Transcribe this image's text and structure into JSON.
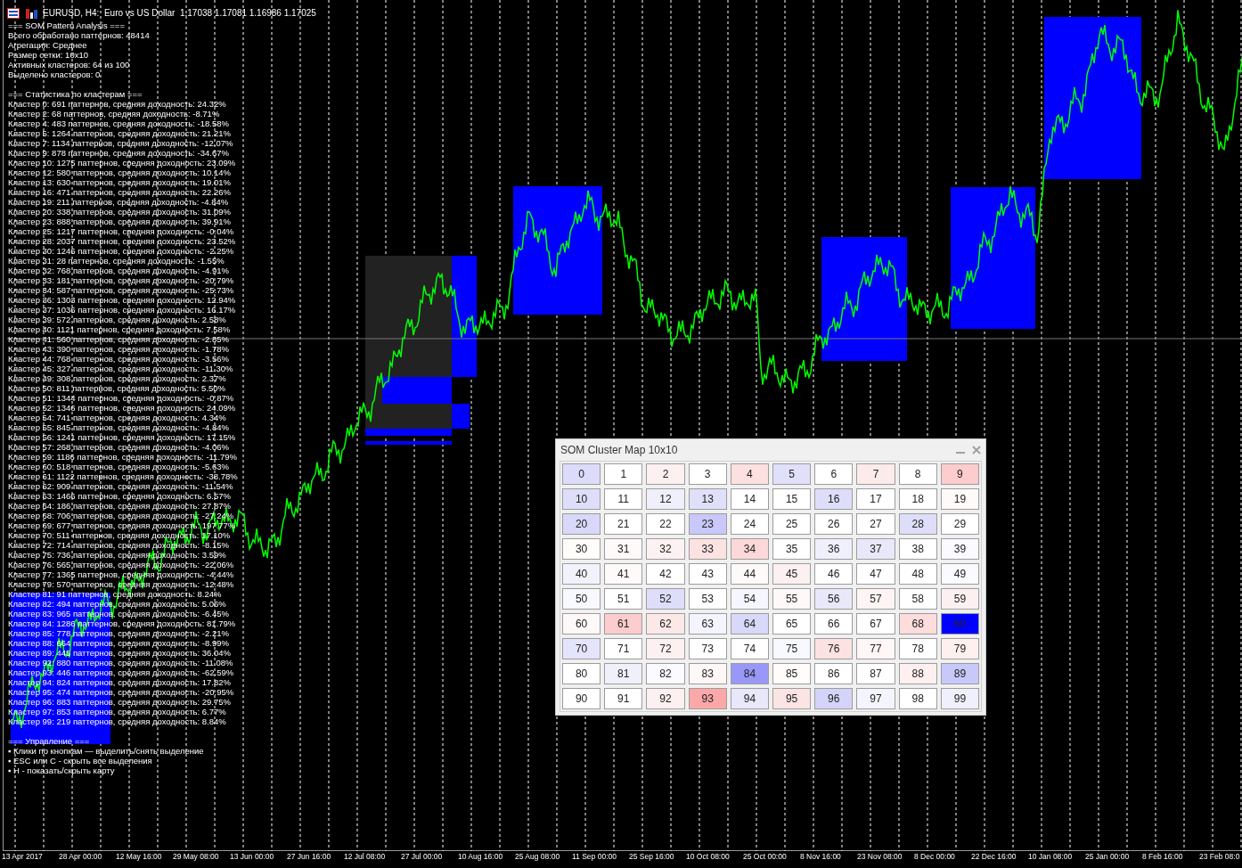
{
  "title_bar": {
    "text": "EURUSD, H4:  Euro vs US Dollar  1.17038 1.17081 1.16986 1.17025"
  },
  "analysis": {
    "header": [
      "=== SOM Pattern Analysis ===",
      "Всего обработано паттернов: 48414",
      "Агрегация: Среднее",
      "Размер сетки: 10x10",
      "Активных кластеров: 64 из 100",
      "Выделено кластеров: 0"
    ],
    "stats_title": "=== Статистика по кластерам ===",
    "clusters": [
      "Кластер 0: 691 паттернов, средняя доходность: 24.32%",
      "Кластер 2: 68 паттернов, средняя доходность: -8.71%",
      "Кластер 4: 483 паттернов, средняя доходность: -18.58%",
      "Кластер 5: 1264 паттернов, средняя доходность: 21.21%",
      "Кластер 7: 1134 паттернов, средняя доходность: -12.07%",
      "Кластер 9: 878 паттернов, средняя доходность: -34.67%",
      "Кластер 10: 1275 паттернов, средняя доходность: 23.09%",
      "Кластер 12: 580 паттернов, средняя доходность: 10.14%",
      "Кластер 13: 630 паттернов, средняя доходность: 19.01%",
      "Кластер 16: 471 паттернов, средняя доходность: 22.26%",
      "Кластер 19: 211 паттернов, средняя доходность: -4.84%",
      "Кластер 20: 338 паттернов, средняя доходность: 31.09%",
      "Кластер 23: 888 паттернов, средняя доходность: 39.91%",
      "Кластер 25: 1217 паттернов, средняя доходность: -0.04%",
      "Кластер 28: 2037 паттернов, средняя доходность: 23.52%",
      "Кластер 30: 1246 паттернов, средняя доходность: -2.25%",
      "Кластер 31: 28 паттернов, средняя доходность: -1.55%",
      "Кластер 32: 768 паттернов, средняя доходность: -4.91%",
      "Кластер 33: 181 паттернов, средняя доходность: -20.79%",
      "Кластер 34: 587 паттернов, средняя доходность: -25.73%",
      "Кластер 36: 1303 паттернов, средняя доходность: 12.94%",
      "Кластер 37: 1036 паттернов, средняя доходность: 16.17%",
      "Кластер 39: 572 паттернов, средняя доходность: 2.58%",
      "Кластер 40: 1121 паттернов, средняя доходность: 7.58%",
      "Кластер 41: 560 паттернов, средняя доходность: -2.85%",
      "Кластер 43: 390 паттернов, средняя доходность: -1.78%",
      "Кластер 44: 768 паттернов, средняя доходность: -3.56%",
      "Кластер 45: 327 паттернов, средняя доходность: -11.30%",
      "Кластер 49: 308 паттернов, средняя доходность: 2.37%",
      "Кластер 50: 811 паттернов, средняя доходность: 5.50%",
      "Кластер 51: 1344 паттернов, средняя доходность: -0.87%",
      "Кластер 52: 1346 паттернов, средняя доходность: 24.09%",
      "Кластер 54: 741 паттернов, средняя доходность: 4.34%",
      "Кластер 55: 845 паттернов, средняя доходность: -4.84%",
      "Кластер 56: 1241 паттернов, средняя доходность: 17.15%",
      "Кластер 57: 268 паттернов, средняя доходность: -4.06%",
      "Кластер 59: 1186 паттернов, средняя доходность: -11.79%",
      "Кластер 60: 518 паттернов, средняя доходность: -5.63%",
      "Кластер 61: 1122 паттернов, средняя доходность: -38.78%",
      "Кластер 62: 909 паттернов, средняя доходность: -11.54%",
      "Кластер 63: 1466 паттернов, средняя доходность: 6.57%",
      "Кластер 64: 186 паттернов, средняя доходность: 27.87%",
      "Кластер 68: 706 паттернов, средняя доходность: -27.24%",
      "Кластер 69: 677 паттернов, средняя доходность: 197.77%",
      "Кластер 70: 511 паттернов, средняя доходность: 17.10%",
      "Кластер 72: 714 паттернов, средняя доходность: -8.15%",
      "Кластер 75: 736 паттернов, средняя доходность: 3.59%",
      "Кластер 76: 565 паттернов, средняя доходность: -22.06%",
      "Кластер 77: 1365 паттернов, средняя доходность: -4.44%",
      "Кластер 79: 570 паттернов, средняя доходность: -12.48%",
      "Кластер 81: 91 паттернов, средняя доходность: 8.24%",
      "Кластер 82: 494 паттернов, средняя доходность: 5.06%",
      "Кластер 83: 965 паттернов, средняя доходность: -6.45%",
      "Кластер 84: 1286 паттернов, средняя доходность: 81.79%",
      "Кластер 85: 778 паттернов, средняя доходность: -2.21%",
      "Кластер 88: 664 паттернов, средняя доходность: -8.99%",
      "Кластер 89: 445 паттернов, средняя доходность: 36.04%",
      "Кластер 92: 880 паттернов, средняя доходность: -11.08%",
      "Кластер 93: 446 паттернов, средняя доходность: -62.59%",
      "Кластер 94: 824 паттернов, средняя доходность: 17.82%",
      "Кластер 95: 474 паттернов, средняя доходность: -20.95%",
      "Кластер 96: 883 паттернов, средняя доходность: 29.75%",
      "Кластер 97: 853 паттернов, средняя доходность: 6.77%",
      "Кластер 99: 219 паттернов, средняя доходность: 8.84%"
    ],
    "controls_title": "=== Управление ===",
    "controls": [
      "▪ Клики по кнопкам — выделить/снять выделение",
      "▪ ESC или C - скрыть все выделения",
      "▪ H - показать/скрыть карту"
    ]
  },
  "cluster_map": {
    "title": "SOM Cluster Map 10x10",
    "cells": [
      {
        "label": "0",
        "color": "#dcdcfa"
      },
      {
        "label": "1",
        "color": "#ffffff"
      },
      {
        "label": "2",
        "color": "#fdf0f0"
      },
      {
        "label": "3",
        "color": "#ffffff"
      },
      {
        "label": "4",
        "color": "#fde0e0"
      },
      {
        "label": "5",
        "color": "#e0e0fa"
      },
      {
        "label": "6",
        "color": "#ffffff"
      },
      {
        "label": "7",
        "color": "#fdeaea"
      },
      {
        "label": "8",
        "color": "#ffffff"
      },
      {
        "label": "9",
        "color": "#fdcccc"
      },
      {
        "label": "10",
        "color": "#dedefa"
      },
      {
        "label": "11",
        "color": "#ffffff"
      },
      {
        "label": "12",
        "color": "#f0f0fc"
      },
      {
        "label": "13",
        "color": "#e0e0fa"
      },
      {
        "label": "14",
        "color": "#ffffff"
      },
      {
        "label": "15",
        "color": "#ffffff"
      },
      {
        "label": "16",
        "color": "#dedefa"
      },
      {
        "label": "17",
        "color": "#ffffff"
      },
      {
        "label": "18",
        "color": "#ffffff"
      },
      {
        "label": "19",
        "color": "#fffafa"
      },
      {
        "label": "20",
        "color": "#d8d8fa"
      },
      {
        "label": "21",
        "color": "#ffffff"
      },
      {
        "label": "22",
        "color": "#ffffff"
      },
      {
        "label": "23",
        "color": "#c8c8fa"
      },
      {
        "label": "24",
        "color": "#ffffff"
      },
      {
        "label": "25",
        "color": "#ffffff"
      },
      {
        "label": "26",
        "color": "#ffffff"
      },
      {
        "label": "27",
        "color": "#ffffff"
      },
      {
        "label": "28",
        "color": "#dedefa"
      },
      {
        "label": "29",
        "color": "#ffffff"
      },
      {
        "label": "30",
        "color": "#fffcfa"
      },
      {
        "label": "31",
        "color": "#fffafa"
      },
      {
        "label": "32",
        "color": "#fdf2f2"
      },
      {
        "label": "33",
        "color": "#fde2e2"
      },
      {
        "label": "34",
        "color": "#fcd8d8"
      },
      {
        "label": "35",
        "color": "#ffffff"
      },
      {
        "label": "36",
        "color": "#f0f0fc"
      },
      {
        "label": "37",
        "color": "#e8e8fa"
      },
      {
        "label": "38",
        "color": "#ffffff"
      },
      {
        "label": "39",
        "color": "#fafaff"
      },
      {
        "label": "40",
        "color": "#f2f2fd"
      },
      {
        "label": "41",
        "color": "#fffafa"
      },
      {
        "label": "42",
        "color": "#ffffff"
      },
      {
        "label": "43",
        "color": "#ffffff"
      },
      {
        "label": "44",
        "color": "#fffafa"
      },
      {
        "label": "45",
        "color": "#fdf0f0"
      },
      {
        "label": "46",
        "color": "#ffffff"
      },
      {
        "label": "47",
        "color": "#ffffff"
      },
      {
        "label": "48",
        "color": "#ffffff"
      },
      {
        "label": "49",
        "color": "#fafaff"
      },
      {
        "label": "50",
        "color": "#f8f8ff"
      },
      {
        "label": "51",
        "color": "#ffffff"
      },
      {
        "label": "52",
        "color": "#dedefa"
      },
      {
        "label": "53",
        "color": "#ffffff"
      },
      {
        "label": "54",
        "color": "#f6f6fe"
      },
      {
        "label": "55",
        "color": "#fff8f8"
      },
      {
        "label": "56",
        "color": "#e8e8fa"
      },
      {
        "label": "57",
        "color": "#fff4f4"
      },
      {
        "label": "58",
        "color": "#ffffff"
      },
      {
        "label": "59",
        "color": "#fdf0f0"
      },
      {
        "label": "60",
        "color": "#fff8f8"
      },
      {
        "label": "61",
        "color": "#fdcccc"
      },
      {
        "label": "62",
        "color": "#fde8e8"
      },
      {
        "label": "63",
        "color": "#f4f4fe"
      },
      {
        "label": "64",
        "color": "#d8d8fa"
      },
      {
        "label": "65",
        "color": "#ffffff"
      },
      {
        "label": "66",
        "color": "#ffffff"
      },
      {
        "label": "67",
        "color": "#ffffff"
      },
      {
        "label": "68",
        "color": "#fcdcdc"
      },
      {
        "label": "69",
        "color": "#0000ff"
      },
      {
        "label": "70",
        "color": "#e4e4fc"
      },
      {
        "label": "71",
        "color": "#ffffff"
      },
      {
        "label": "72",
        "color": "#fdf0f0"
      },
      {
        "label": "73",
        "color": "#ffffff"
      },
      {
        "label": "74",
        "color": "#ffffff"
      },
      {
        "label": "75",
        "color": "#f8f8ff"
      },
      {
        "label": "76",
        "color": "#fde2e2"
      },
      {
        "label": "77",
        "color": "#fff6f6"
      },
      {
        "label": "78",
        "color": "#ffffff"
      },
      {
        "label": "79",
        "color": "#fff0f0"
      },
      {
        "label": "80",
        "color": "#ffffff"
      },
      {
        "label": "81",
        "color": "#f0f0fc"
      },
      {
        "label": "82",
        "color": "#fafaff"
      },
      {
        "label": "83",
        "color": "#fff6f6"
      },
      {
        "label": "84",
        "color": "#9898f8"
      },
      {
        "label": "85",
        "color": "#fffcfa"
      },
      {
        "label": "86",
        "color": "#ffffff"
      },
      {
        "label": "87",
        "color": "#ffffff"
      },
      {
        "label": "88",
        "color": "#fff0f0"
      },
      {
        "label": "89",
        "color": "#c8c8fa"
      },
      {
        "label": "90",
        "color": "#ffffff"
      },
      {
        "label": "91",
        "color": "#ffffff"
      },
      {
        "label": "92",
        "color": "#fdf0f0"
      },
      {
        "label": "93",
        "color": "#fca8a8"
      },
      {
        "label": "94",
        "color": "#e8e8fa"
      },
      {
        "label": "95",
        "color": "#fde4e4"
      },
      {
        "label": "96",
        "color": "#d4d4fa"
      },
      {
        "label": "97",
        "color": "#f4f4fe"
      },
      {
        "label": "98",
        "color": "#ffffff"
      },
      {
        "label": "99",
        "color": "#f0f0fc"
      }
    ]
  },
  "time_axis": [
    "13 Apr 2017",
    "28 Apr 00:00",
    "12 May 16:00",
    "29 May 08:00",
    "13 Jun 00:00",
    "27 Jun 16:00",
    "12 Jul 08:00",
    "27 Jul 00:00",
    "10 Aug 16:00",
    "25 Aug 08:00",
    "11 Sep 00:00",
    "25 Sep 16:00",
    "10 Oct 08:00",
    "25 Oct 00:00",
    "8 Nov 16:00",
    "23 Nov 08:00",
    "8 Dec 00:00",
    "22 Dec 16:00",
    "10 Jan 08:00",
    "25 Jan 00:00",
    "8 Feb 16:00",
    "23 Feb 08:0"
  ]
}
